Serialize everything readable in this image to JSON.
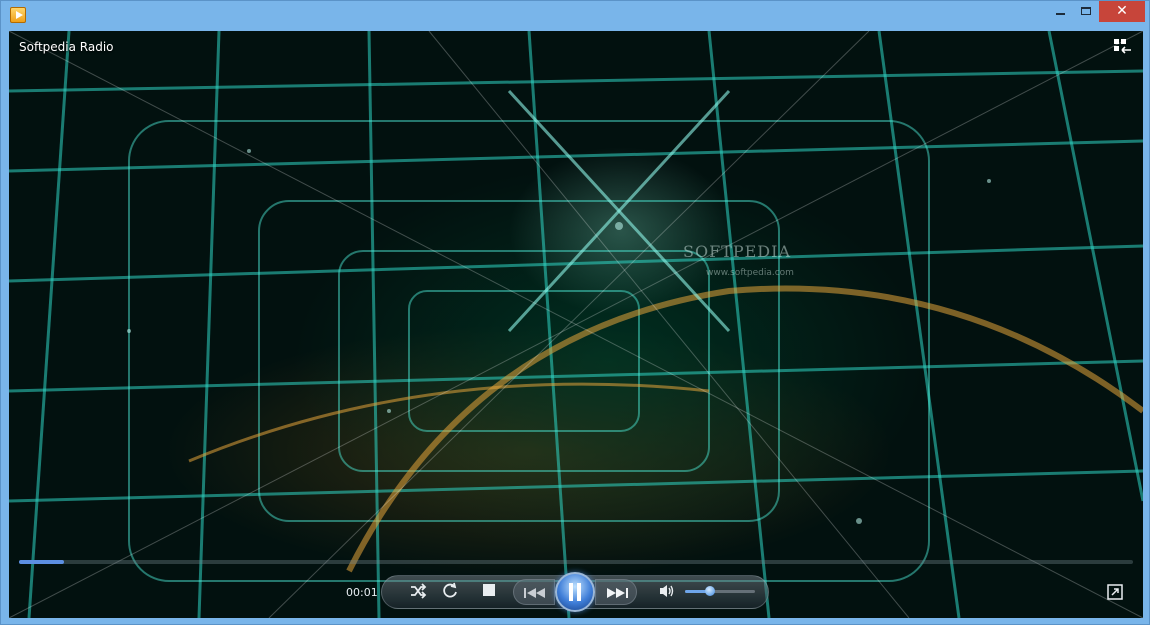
{
  "window": {
    "title": "Softpedia Radio",
    "close_glyph": "✕",
    "icons": {
      "app": "media-player-icon",
      "minimize": "minimize-icon",
      "maximize": "maximize-icon",
      "close": "close-icon"
    }
  },
  "player": {
    "elapsed": "00:01",
    "seek_progress_percent": 4,
    "volume_percent": 35,
    "watermark": "SOFTPEDIA",
    "watermark_url": "www.softpedia.com",
    "controls": [
      "shuffle-icon",
      "repeat-icon",
      "stop-icon",
      "previous-icon",
      "pause-icon",
      "next-icon",
      "volume-icon",
      "fullscreen-icon",
      "switch-to-library-icon"
    ]
  },
  "colors": {
    "accent": "#3f7ed8",
    "close_button": "#c7453a",
    "titlebar": "#79b5ea"
  }
}
